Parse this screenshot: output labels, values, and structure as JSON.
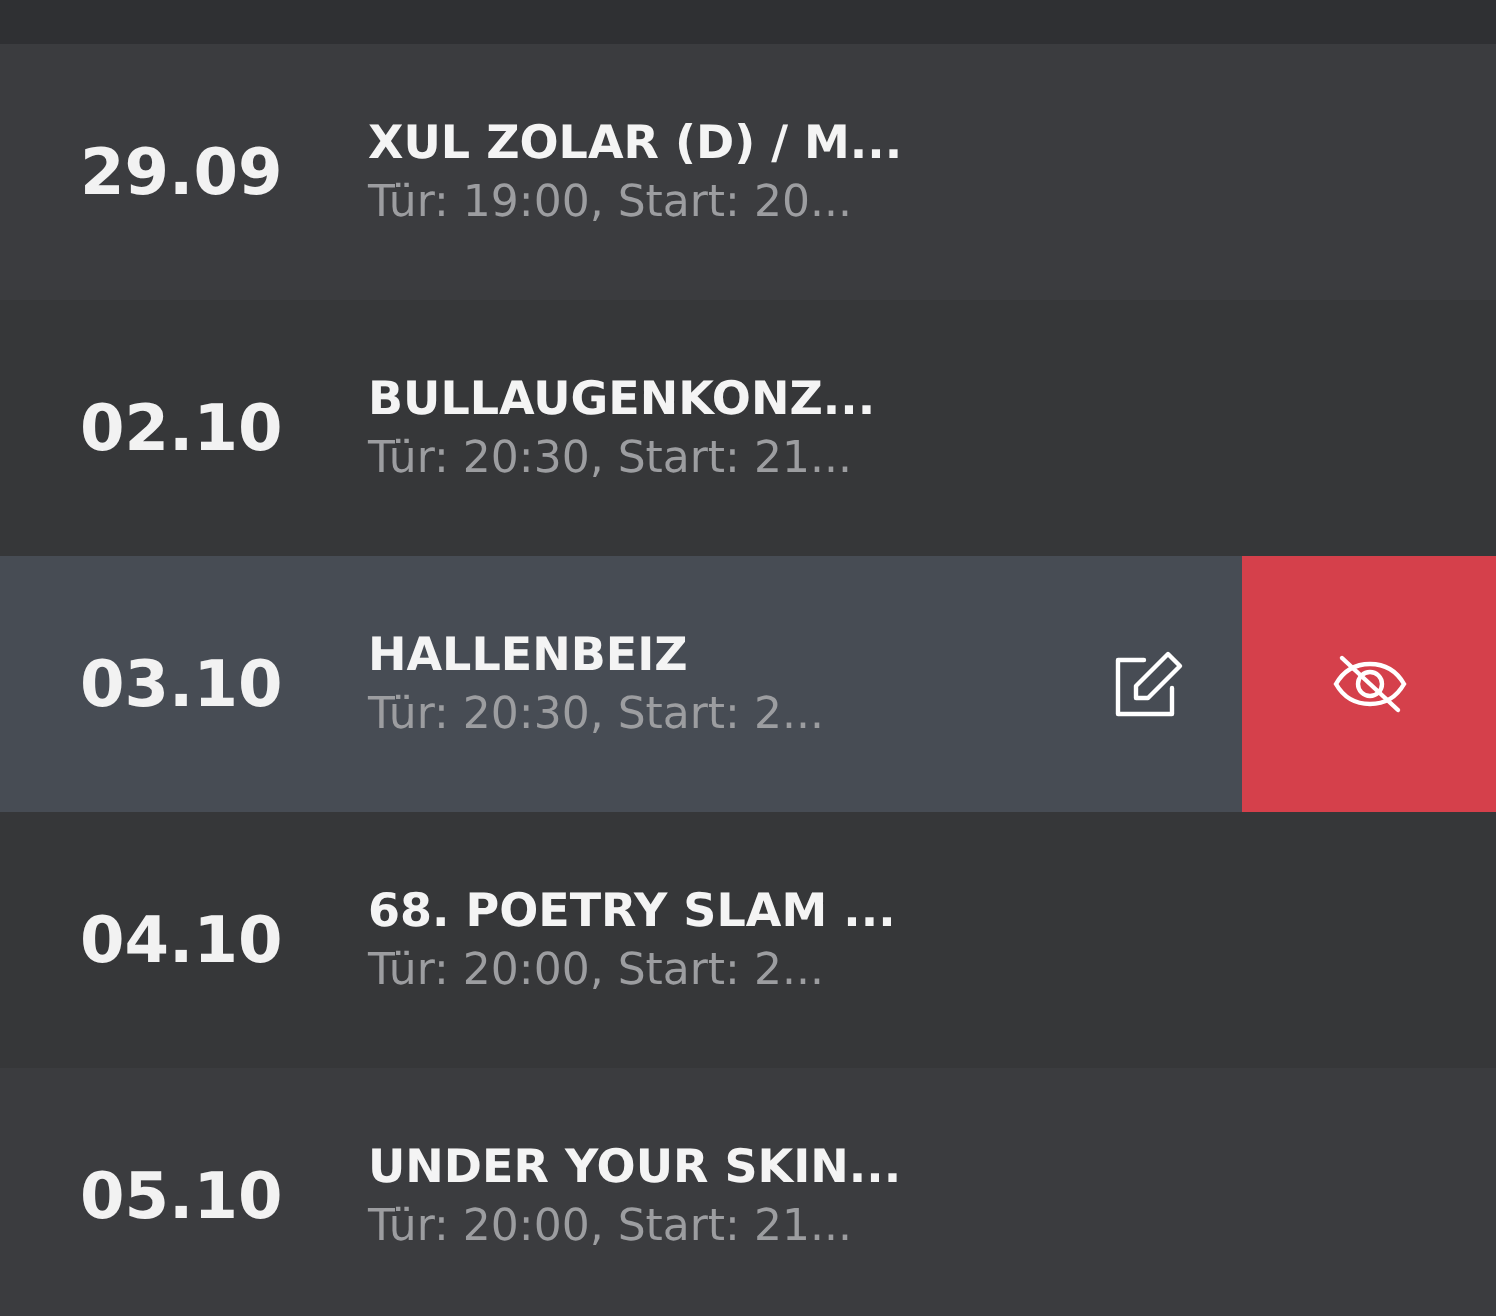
{
  "events": [
    {
      "date": "29.09",
      "title": "XUL ZOLAR (D) / M...",
      "subtitle": "Tür: 19:00, Start: 20...",
      "selected": false
    },
    {
      "date": "02.10",
      "title": "BULLAUGENKONZ...",
      "subtitle": "Tür: 20:30, Start: 21...",
      "selected": false
    },
    {
      "date": "03.10",
      "title": "HALLENBEIZ",
      "subtitle": "Tür: 20:30, Start: 2...",
      "selected": true
    },
    {
      "date": "04.10",
      "title": "68. POETRY SLAM ...",
      "subtitle": "Tür: 20:00, Start: 2...",
      "selected": false
    },
    {
      "date": "05.10",
      "title": "UNDER YOUR SKIN...",
      "subtitle": "Tür: 20:00, Start: 21...",
      "selected": false
    }
  ]
}
